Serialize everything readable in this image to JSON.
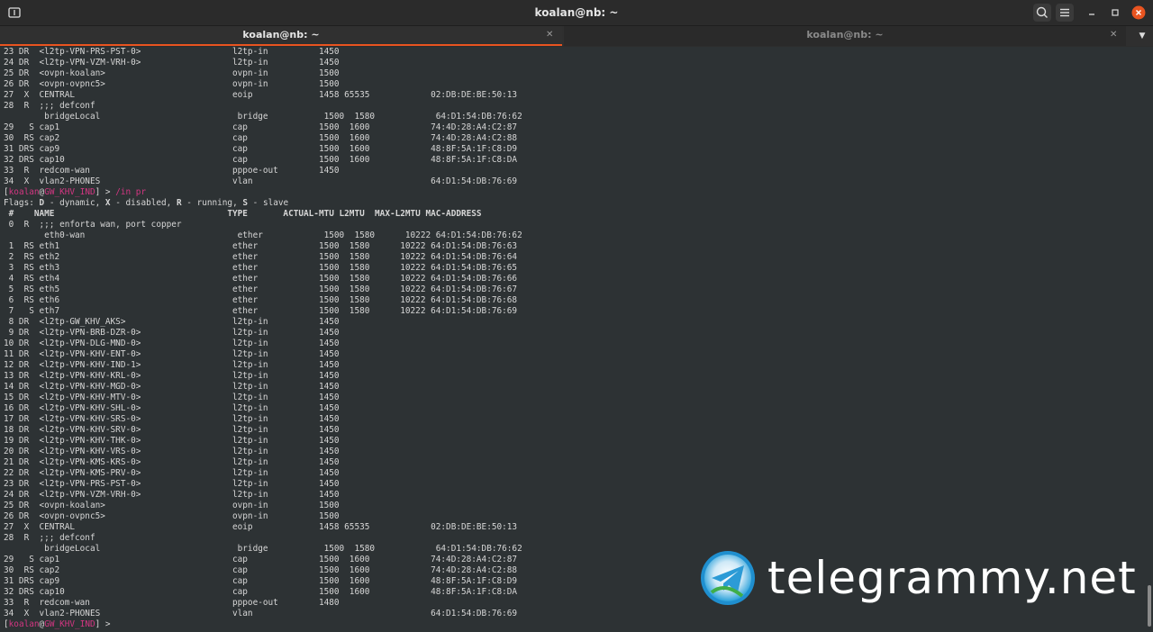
{
  "window": {
    "title": "koalan@nb: ~",
    "new_tab_icon": "new-tab-icon",
    "search_icon": "search-icon",
    "menu_icon": "hamburger-menu-icon"
  },
  "tabs": [
    {
      "label": "koalan@nb: ~",
      "active": true
    },
    {
      "label": "koalan@nb: ~",
      "active": false
    }
  ],
  "terminal": {
    "top_lines": [
      "23 DR  <l2tp-VPN-PRS-PST-0>                  l2tp-in          1450",
      "24 DR  <l2tp-VPN-VZM-VRH-0>                  l2tp-in          1450",
      "25 DR  <ovpn-koalan>                         ovpn-in          1500",
      "26 DR  <ovpn-ovpnc5>                         ovpn-in          1500",
      "27  X  CENTRAL                               eoip             1458 65535            02:DB:DE:BE:50:13",
      "28  R  ;;; defconf",
      "        bridgeLocal                           bridge           1500  1580            64:D1:54:DB:76:62",
      "29   S cap1                                  cap              1500  1600            74:4D:28:A4:C2:87",
      "30  RS cap2                                  cap              1500  1600            74:4D:28:A4:C2:88",
      "31 DRS cap9                                  cap              1500  1600            48:8F:5A:1F:C8:D9",
      "32 DRS cap10                                 cap              1500  1600            48:8F:5A:1F:C8:DA",
      "33  R  redcom-wan                            pppoe-out        1450",
      "34  X  vlan2-PHONES                          vlan                                   64:D1:54:DB:76:69"
    ],
    "prompt_user": "koalan",
    "prompt_at": "@",
    "prompt_host": "GW_KHV_IND",
    "prompt_suffix": "] > ",
    "command": "/in pr",
    "flags_line": "Flags: D - dynamic, X - disabled, R - running, S - slave",
    "header_line": " #    NAME                                  TYPE       ACTUAL-MTU L2MTU  MAX-L2MTU MAC-ADDRESS",
    "body_lines": [
      " 0  R  ;;; enforta wan, port copper",
      "        eth0-wan                              ether            1500  1580      10222 64:D1:54:DB:76:62",
      " 1  RS eth1                                  ether            1500  1580      10222 64:D1:54:DB:76:63",
      " 2  RS eth2                                  ether            1500  1580      10222 64:D1:54:DB:76:64",
      " 3  RS eth3                                  ether            1500  1580      10222 64:D1:54:DB:76:65",
      " 4  RS eth4                                  ether            1500  1580      10222 64:D1:54:DB:76:66",
      " 5  RS eth5                                  ether            1500  1580      10222 64:D1:54:DB:76:67",
      " 6  RS eth6                                  ether            1500  1580      10222 64:D1:54:DB:76:68",
      " 7   S eth7                                  ether            1500  1580      10222 64:D1:54:DB:76:69",
      " 8 DR  <l2tp-GW_KHV_AKS>                     l2tp-in          1450",
      " 9 DR  <l2tp-VPN-BRB-DZR-0>                  l2tp-in          1450",
      "10 DR  <l2tp-VPN-DLG-MND-0>                  l2tp-in          1450",
      "11 DR  <l2tp-VPN-KHV-ENT-0>                  l2tp-in          1450",
      "12 DR  <l2tp-VPN-KHV-IND-1>                  l2tp-in          1450",
      "13 DR  <l2tp-VPN-KHV-KRL-0>                  l2tp-in          1450",
      "14 DR  <l2tp-VPN-KHV-MGD-0>                  l2tp-in          1450",
      "15 DR  <l2tp-VPN-KHV-MTV-0>                  l2tp-in          1450",
      "16 DR  <l2tp-VPN-KHV-SHL-0>                  l2tp-in          1450",
      "17 DR  <l2tp-VPN-KHV-SRS-0>                  l2tp-in          1450",
      "18 DR  <l2tp-VPN-KHV-SRV-0>                  l2tp-in          1450",
      "19 DR  <l2tp-VPN-KHV-THK-0>                  l2tp-in          1450",
      "20 DR  <l2tp-VPN-KHV-VRS-0>                  l2tp-in          1450",
      "21 DR  <l2tp-VPN-KMS-KRS-0>                  l2tp-in          1450",
      "22 DR  <l2tp-VPN-KMS-PRV-0>                  l2tp-in          1450",
      "23 DR  <l2tp-VPN-PRS-PST-0>                  l2tp-in          1450",
      "24 DR  <l2tp-VPN-VZM-VRH-0>                  l2tp-in          1450",
      "25 DR  <ovpn-koalan>                         ovpn-in          1500",
      "26 DR  <ovpn-ovpnc5>                         ovpn-in          1500",
      "27  X  CENTRAL                               eoip             1458 65535            02:DB:DE:BE:50:13",
      "28  R  ;;; defconf",
      "        bridgeLocal                           bridge           1500  1580            64:D1:54:DB:76:62",
      "29   S cap1                                  cap              1500  1600            74:4D:28:A4:C2:87",
      "30  RS cap2                                  cap              1500  1600            74:4D:28:A4:C2:88",
      "31 DRS cap9                                  cap              1500  1600            48:8F:5A:1F:C8:D9",
      "32 DRS cap10                                 cap              1500  1600            48:8F:5A:1F:C8:DA",
      "33  R  redcom-wan                            pppoe-out        1480",
      "34  X  vlan2-PHONES                          vlan                                   64:D1:54:DB:76:69"
    ]
  },
  "watermark": {
    "text": "telegrammy.net",
    "logo_icon": "telegram-logo-icon"
  },
  "colors": {
    "accent": "#e95420",
    "prompt": "#d33682",
    "terminal_bg": "#2d3234"
  }
}
